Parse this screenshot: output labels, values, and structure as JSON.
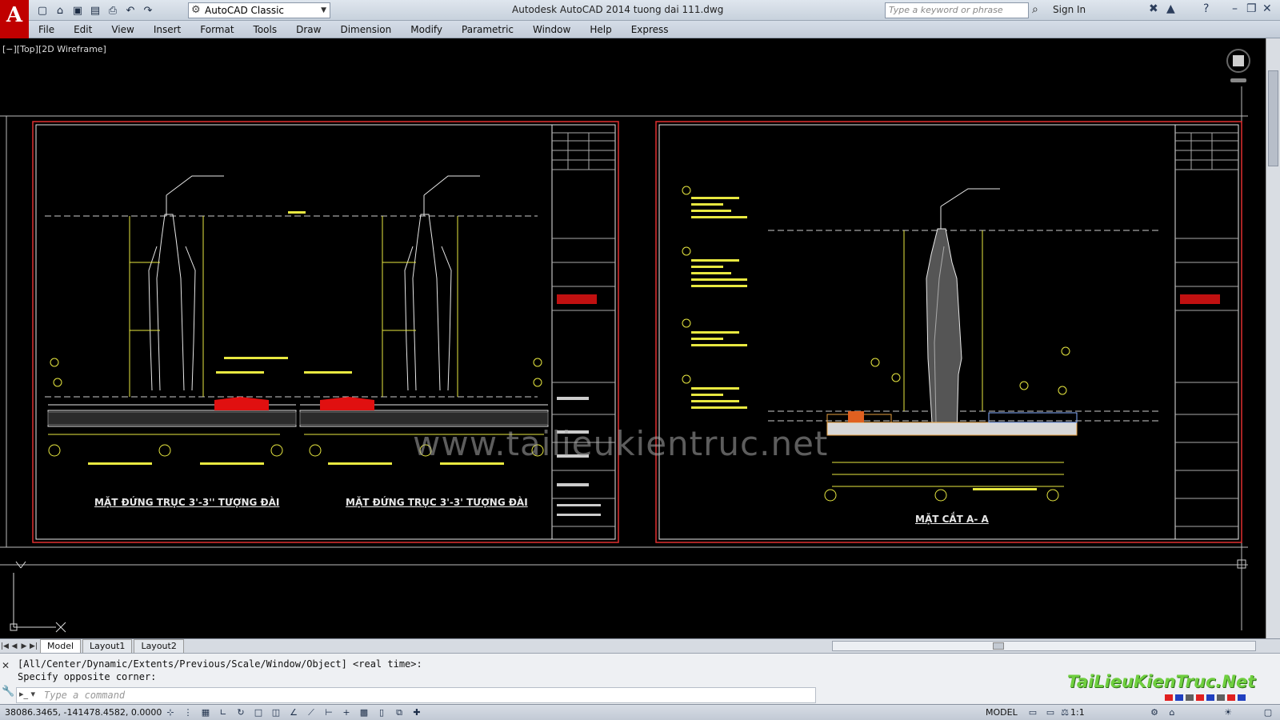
{
  "window": {
    "title": "Autodesk AutoCAD 2014    tuong dai 111.dwg",
    "logo": "A",
    "workspace": "AutoCAD Classic",
    "search_placeholder": "Type a keyword or phrase",
    "sign_in": "Sign In"
  },
  "menu": [
    "File",
    "Edit",
    "View",
    "Insert",
    "Format",
    "Tools",
    "Draw",
    "Dimension",
    "Modify",
    "Parametric",
    "Window",
    "Help",
    "Express"
  ],
  "viewport": {
    "label": "[−][Top][2D Wireframe]"
  },
  "drawing": {
    "left_sheet": {
      "title1": "MẶT ĐỨNG TRỤC 3'-3'' TƯỢNG ĐÀI",
      "title2": "MẶT ĐỨNG TRỤC 3'-3' TƯỢNG ĐÀI"
    },
    "right_sheet": {
      "title": "MẶT CẮT A- A"
    },
    "watermark": "www.tailieukientruc.net"
  },
  "tabs": [
    "Model",
    "Layout1",
    "Layout2"
  ],
  "active_tab": "Model",
  "command": {
    "history_line1": "[All/Center/Dynamic/Extents/Previous/Scale/Window/Object] <real time>:",
    "history_line2": "Specify opposite corner:",
    "input_placeholder": "Type a command"
  },
  "status": {
    "coordinates": "38086.3465, -141478.4582, 0.0000",
    "space": "MODEL",
    "scale": "1:1"
  },
  "brand_watermark": "TaiLieuKienTruc.Net",
  "colors": {
    "sheet_border": "#e03030",
    "line_white": "#e8e8e8",
    "line_yellow": "#e8e840",
    "hatch_red": "#e01010",
    "green_text": "#6fcf3f"
  }
}
